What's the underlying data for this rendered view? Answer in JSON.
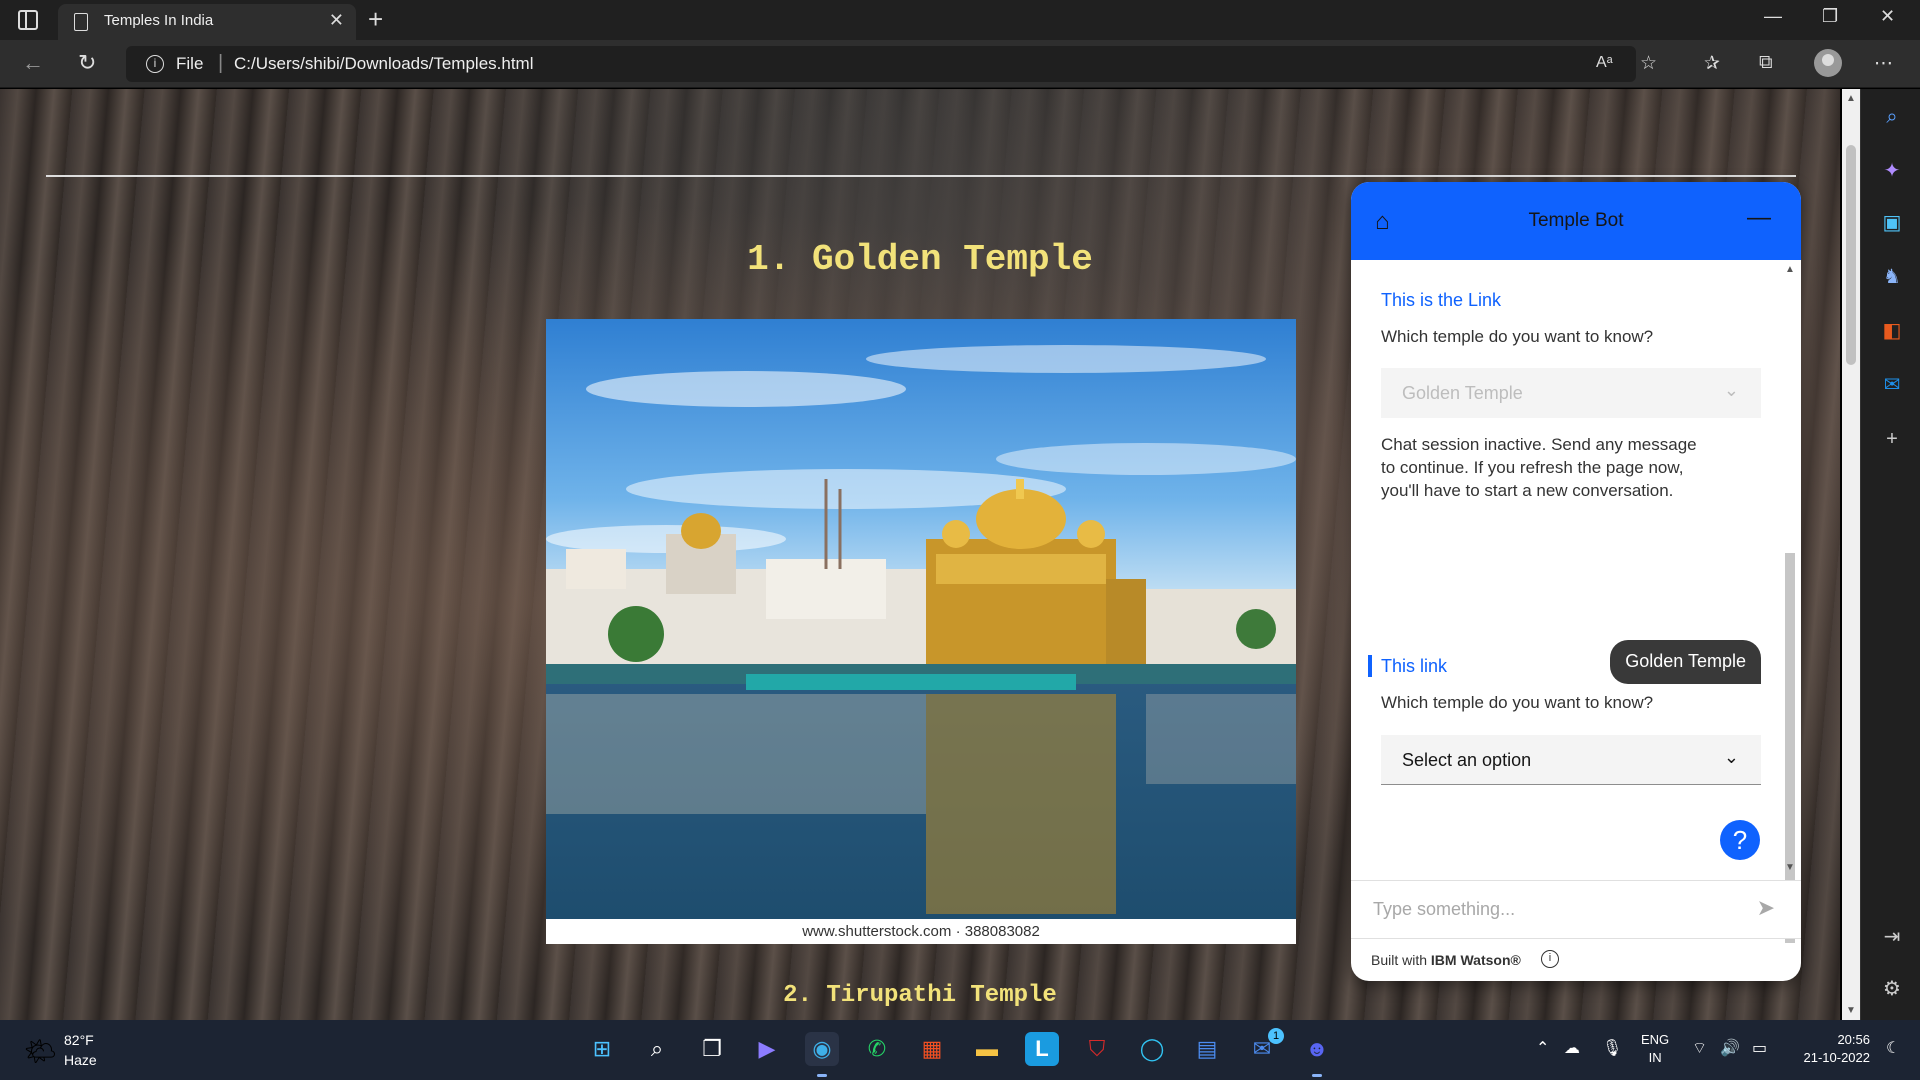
{
  "browser": {
    "tab_title": "Temples In India",
    "tab_close": "✕",
    "new_tab": "+",
    "window_controls": {
      "minimize": "—",
      "restore": "❐",
      "close": "✕"
    },
    "address": {
      "scheme_label": "File",
      "url": "C:/Users/shibi/Downloads/Temples.html",
      "separator": "|",
      "info_glyph": "i"
    }
  },
  "page": {
    "heading1": "1. Golden Temple",
    "image_caption": "www.shutterstock.com · 388083082",
    "heading2": "2. Tirupathi Temple"
  },
  "chatbot": {
    "title": "Temple Bot",
    "messages": [
      {
        "link": "This is the Link",
        "question": "Which temple do you want to know?",
        "dropdown": "Golden Temple"
      }
    ],
    "inactive_notice": "Chat session inactive. Send any message to continue. If you refresh the page now, you'll have to start a new conversation.",
    "user_message": "Golden Temple",
    "second_link": "This link",
    "second_question": "Which temple do you want to know?",
    "second_dropdown": "Select an option",
    "help_label": "?",
    "input_placeholder": "Type something...",
    "footer_prefix": "Built with ",
    "footer_brand": "IBM Watson®",
    "footer_info": "i",
    "accent_color": "#0f62fe"
  },
  "taskbar": {
    "temperature": "82°F",
    "condition": "Haze",
    "language_line1": "ENG",
    "language_line2": "IN",
    "time": "20:56",
    "date": "21-10-2022",
    "mail_badge": "1"
  }
}
